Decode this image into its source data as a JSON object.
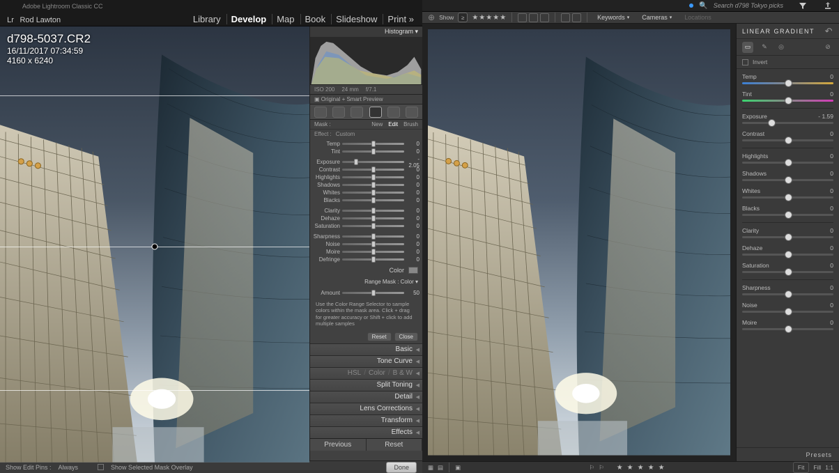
{
  "left": {
    "app_name": "Adobe Lightroom Classic CC",
    "lr_glyph": "Lr",
    "user": "Rod Lawton",
    "modules": [
      "Library",
      "Develop",
      "Map",
      "Book",
      "Slideshow",
      "Print »"
    ],
    "active_module": "Develop",
    "file": {
      "name": "d798-5037.CR2",
      "date": "16/11/2017 07:34:59",
      "dims": "4160 x 6240"
    },
    "histogram_label": "Histogram ▾",
    "hist_info": {
      "iso": "ISO 200",
      "focal": "24 mm",
      "ap": "f/7.1"
    },
    "smart_preview": "▣ Original + Smart Preview",
    "toolstrip": [
      "crop",
      "spot",
      "eye",
      "grad",
      "radial",
      "brush"
    ],
    "selected_tool": "grad",
    "mask_row": {
      "first": "Mask :",
      "tabs": [
        "New",
        "Edit",
        "Brush"
      ],
      "active": "Edit"
    },
    "effect_row": {
      "label": "Effect :",
      "value": "Custom"
    },
    "sliders": [
      {
        "label": "Temp",
        "val": "0",
        "pos": 50
      },
      {
        "label": "Tint",
        "val": "0",
        "pos": 50
      },
      {
        "sep": true
      },
      {
        "label": "Exposure",
        "val": "- 2.05",
        "pos": 22
      },
      {
        "label": "Contrast",
        "val": "0",
        "pos": 50
      },
      {
        "label": "Highlights",
        "val": "0",
        "pos": 50
      },
      {
        "label": "Shadows",
        "val": "0",
        "pos": 50
      },
      {
        "label": "Whites",
        "val": "0",
        "pos": 50
      },
      {
        "label": "Blacks",
        "val": "0",
        "pos": 50
      },
      {
        "sep": true
      },
      {
        "label": "Clarity",
        "val": "0",
        "pos": 50
      },
      {
        "label": "Dehaze",
        "val": "0",
        "pos": 50
      },
      {
        "label": "Saturation",
        "val": "0",
        "pos": 50
      },
      {
        "sep": true
      },
      {
        "label": "Sharpness",
        "val": "0",
        "pos": 50
      },
      {
        "label": "Noise",
        "val": "0",
        "pos": 50
      },
      {
        "label": "Moire",
        "val": "0",
        "pos": 50
      },
      {
        "label": "Defringe",
        "val": "0",
        "pos": 50
      }
    ],
    "color_label": "Color",
    "range_mask": "Range Mask : Color ▾",
    "amount": {
      "label": "Amount",
      "val": "50",
      "pos": 50
    },
    "hint": "Use the Color Range Selector to sample colors within the mask area. Click + drag for greater accuracy or Shift + click to add multiple samples",
    "reset_btn": "Reset",
    "close_btn": "Close",
    "accordion": [
      "Basic",
      "Tone Curve",
      "HSL / Color / B & W",
      "Split Toning",
      "Detail",
      "Lens Corrections",
      "Transform",
      "Effects"
    ],
    "footer": {
      "edit_pins": "Show Edit Pins :",
      "edit_pins_val": "Always",
      "mask_overlay": "Show Selected Mask Overlay",
      "done": "Done",
      "previous": "Previous",
      "reset": "Reset"
    }
  },
  "right": {
    "search_placeholder": "Search d798 Tokyo picks",
    "strip": {
      "show": "Show",
      "keywords": "Keywords",
      "cameras": "Cameras",
      "locations": "Locations"
    },
    "panel_title": "LINEAR GRADIENT",
    "invert": "Invert",
    "sliders": [
      {
        "label": "Temp",
        "val": "0",
        "pos": 50,
        "track": "temp"
      },
      {
        "label": "Tint",
        "val": "0",
        "pos": 50,
        "track": "tint"
      },
      {
        "sep": true
      },
      {
        "label": "Exposure",
        "val": "- 1.59",
        "pos": 32
      },
      {
        "label": "Contrast",
        "val": "0",
        "pos": 50
      },
      {
        "sep": true
      },
      {
        "label": "Highlights",
        "val": "0",
        "pos": 50
      },
      {
        "label": "Shadows",
        "val": "0",
        "pos": 50
      },
      {
        "label": "Whites",
        "val": "0",
        "pos": 50
      },
      {
        "label": "Blacks",
        "val": "0",
        "pos": 50
      },
      {
        "sep": true
      },
      {
        "label": "Clarity",
        "val": "0",
        "pos": 50
      },
      {
        "label": "Dehaze",
        "val": "0",
        "pos": 50
      },
      {
        "label": "Saturation",
        "val": "0",
        "pos": 50
      },
      {
        "sep": true
      },
      {
        "label": "Sharpness",
        "val": "0",
        "pos": 50
      },
      {
        "label": "Noise",
        "val": "0",
        "pos": 50
      },
      {
        "label": "Moire",
        "val": "0",
        "pos": 50
      }
    ],
    "presets": "Presets",
    "bottombar": {
      "fit": "Fit",
      "fill": "Fill",
      "oneone": "1:1"
    }
  }
}
